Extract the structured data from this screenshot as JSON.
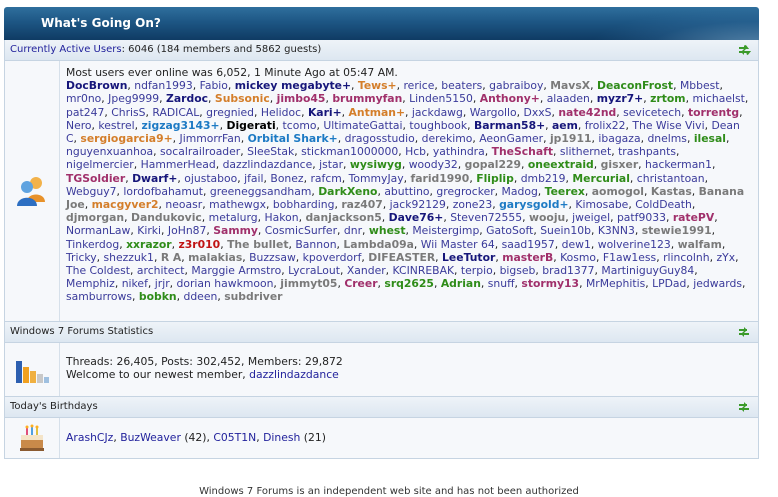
{
  "header": {
    "title": "What's Going On?"
  },
  "online": {
    "bar_label": "Currently Active Users",
    "bar_count": ": 6046 (184 members and 5862 guests)",
    "most_ever": "Most users ever online was 6,052, 1 Minute Ago at 05:47 AM.",
    "users_html_note": "list of user names",
    "users": [
      [
        "DocBrown",
        "ud"
      ],
      [
        "ndfan1993",
        "u"
      ],
      [
        "Fabio",
        "u"
      ],
      [
        "mickey megabyte+",
        "ud"
      ],
      [
        "Tews+",
        "ul"
      ],
      [
        "rerice",
        "u"
      ],
      [
        "beaters",
        "u"
      ],
      [
        "gabraiboy",
        "u"
      ],
      [
        "MavsX",
        "ug"
      ],
      [
        "DeaconFrost",
        "uf"
      ],
      [
        "Mbbest",
        "u"
      ],
      [
        "mr0no",
        "u"
      ],
      [
        "Jpeg9999",
        "u"
      ],
      [
        "Zardoc",
        "ud"
      ],
      [
        "Subsonic",
        "ul"
      ],
      [
        "jimbo45",
        "um"
      ],
      [
        "brummyfan",
        "um"
      ],
      [
        "Linden5150",
        "u"
      ],
      [
        "Anthony+",
        "um"
      ],
      [
        "alaaden",
        "u"
      ],
      [
        "myzr7+",
        "ud"
      ],
      [
        "zrtom",
        "uf"
      ],
      [
        "michaelst",
        "u"
      ],
      [
        "pat247",
        "u"
      ],
      [
        "ChrisS",
        "u"
      ],
      [
        "RADICAL",
        "u"
      ],
      [
        "gregnied",
        "u"
      ],
      [
        "Helidoc",
        "u"
      ],
      [
        "Kari+",
        "ud"
      ],
      [
        "Antman+",
        "ul"
      ],
      [
        "jackdawg",
        "u"
      ],
      [
        "Wargollo",
        "u"
      ],
      [
        "DxxS",
        "u"
      ],
      [
        "nate42nd",
        "um"
      ],
      [
        "sevicetech",
        "u"
      ],
      [
        "torrentg",
        "um"
      ],
      [
        "Nero",
        "u"
      ],
      [
        "kestrel",
        "u"
      ],
      [
        "zigzag3143+",
        "uc"
      ],
      [
        "Digerati",
        "ub"
      ],
      [
        "tcomo",
        "u"
      ],
      [
        "UltimateGattai",
        "u"
      ],
      [
        "toughbook",
        "u"
      ],
      [
        "Barman58+",
        "ud"
      ],
      [
        "aem",
        "ud"
      ],
      [
        "frolix22",
        "u"
      ],
      [
        "The Wise Vivi",
        "u"
      ],
      [
        "Dean C",
        "u"
      ],
      [
        "sergiogarcia9+",
        "ul"
      ],
      [
        "JimmorrFan",
        "u"
      ],
      [
        "Orbital Shark+",
        "uc"
      ],
      [
        "dragosstudio",
        "u"
      ],
      [
        "derekimo",
        "u"
      ],
      [
        "AeonGamer",
        "u"
      ],
      [
        "jp1911",
        "ug"
      ],
      [
        "ibagaza",
        "u"
      ],
      [
        "dnelms",
        "u"
      ],
      [
        "ilesal",
        "uf"
      ],
      [
        "nguyenxuanhoa",
        "u"
      ],
      [
        "socalrailroader",
        "u"
      ],
      [
        "SleeStak",
        "u"
      ],
      [
        "stickman1000000",
        "u"
      ],
      [
        "Hcb",
        "u"
      ],
      [
        "yathindra",
        "u"
      ],
      [
        "TheSchaft",
        "um"
      ],
      [
        "slithernet",
        "u"
      ],
      [
        "trashpants",
        "u"
      ],
      [
        "nigelmercier",
        "u"
      ],
      [
        "HammerHead",
        "u"
      ],
      [
        "dazzlindazdance",
        "u"
      ],
      [
        "jstar",
        "u"
      ],
      [
        "wysiwyg",
        "uf"
      ],
      [
        "woody32",
        "u"
      ],
      [
        "gopal229",
        "ug"
      ],
      [
        "oneextraid",
        "uf"
      ],
      [
        "gisxer",
        "ug"
      ],
      [
        "hackerman1",
        "u"
      ],
      [
        "TGSoldier",
        "um"
      ],
      [
        "Dwarf+",
        "ud"
      ],
      [
        "ojustaboo",
        "u"
      ],
      [
        "jfail",
        "u"
      ],
      [
        "Bonez",
        "u"
      ],
      [
        "rafcm",
        "u"
      ],
      [
        "TommyJay",
        "u"
      ],
      [
        "farid1990",
        "ug"
      ],
      [
        "Fliplip",
        "uf"
      ],
      [
        "dmb219",
        "u"
      ],
      [
        "Mercurial",
        "uf"
      ],
      [
        "christantoan",
        "u"
      ],
      [
        "Webguy7",
        "u"
      ],
      [
        "lordofbahamut",
        "u"
      ],
      [
        "greeneggsandham",
        "u"
      ],
      [
        "DarkXeno",
        "uf"
      ],
      [
        "abuttino",
        "u"
      ],
      [
        "gregrocker",
        "u"
      ],
      [
        "Madog",
        "u"
      ],
      [
        "Teerex",
        "uf"
      ],
      [
        "aomogol",
        "ug"
      ],
      [
        "Kastas",
        "ug"
      ],
      [
        "Banana Joe",
        "ug"
      ],
      [
        "macgyver2",
        "ul"
      ],
      [
        "neoasr",
        "u"
      ],
      [
        "mathewgx",
        "u"
      ],
      [
        "bobharding",
        "u"
      ],
      [
        "raz407",
        "ug"
      ],
      [
        "jack92129",
        "u"
      ],
      [
        "zone23",
        "u"
      ],
      [
        "garysgold+",
        "uc"
      ],
      [
        "Kimosabe",
        "u"
      ],
      [
        "ColdDeath",
        "u"
      ],
      [
        "djmorgan",
        "ug"
      ],
      [
        "Dandukovic",
        "ug"
      ],
      [
        "metalurg",
        "u"
      ],
      [
        "Hakon",
        "u"
      ],
      [
        "danjackson5",
        "ug"
      ],
      [
        "Dave76+",
        "ud"
      ],
      [
        "Steven72555",
        "u"
      ],
      [
        "wooju",
        "ug"
      ],
      [
        "jweigel",
        "u"
      ],
      [
        "patf9033",
        "u"
      ],
      [
        "ratePV",
        "um"
      ],
      [
        "NormanLaw",
        "u"
      ],
      [
        "Kirki",
        "u"
      ],
      [
        "JoHn87",
        "u"
      ],
      [
        "Sammy",
        "um"
      ],
      [
        "CosmicSurfer",
        "u"
      ],
      [
        "dnr",
        "u"
      ],
      [
        "whest",
        "uf"
      ],
      [
        "Meistergimp",
        "u"
      ],
      [
        "GatoSoft",
        "u"
      ],
      [
        "Suein10b",
        "u"
      ],
      [
        "K3NN3",
        "u"
      ],
      [
        "stewie1991",
        "ug"
      ],
      [
        "Tinkerdog",
        "u"
      ],
      [
        "xxrazor",
        "uf"
      ],
      [
        "z3r010",
        "ur"
      ],
      [
        "The bullet",
        "ug"
      ],
      [
        "Bannon",
        "u"
      ],
      [
        "Lambda09a",
        "ug"
      ],
      [
        "Wii Master 64",
        "u"
      ],
      [
        "saad1957",
        "u"
      ],
      [
        "dew1",
        "u"
      ],
      [
        "wolverine123",
        "u"
      ],
      [
        "walfam",
        "ug"
      ],
      [
        "Tricky",
        "u"
      ],
      [
        "shezzuk1",
        "u"
      ],
      [
        "R A",
        "ug"
      ],
      [
        "malakias",
        "ug"
      ],
      [
        "Buzzsaw",
        "u"
      ],
      [
        "kpoverdorf",
        "u"
      ],
      [
        "DIFEASTER",
        "ug"
      ],
      [
        "LeeTutor",
        "ud"
      ],
      [
        "masterB",
        "um"
      ],
      [
        "Kosmo",
        "u"
      ],
      [
        "F1aw1ess",
        "u"
      ],
      [
        "rlincolnh",
        "u"
      ],
      [
        "zYx",
        "u"
      ],
      [
        "The Coldest",
        "u"
      ],
      [
        "architect",
        "u"
      ],
      [
        "Marggie Armstro",
        "u"
      ],
      [
        "LycraLout",
        "u"
      ],
      [
        "Xander",
        "u"
      ],
      [
        "KCINREBAK",
        "u"
      ],
      [
        "terpio",
        "u"
      ],
      [
        "bigseb",
        "u"
      ],
      [
        "brad1377",
        "u"
      ],
      [
        "MartiniguyGuy84",
        "u"
      ],
      [
        "Memphiz",
        "u"
      ],
      [
        "nikef",
        "u"
      ],
      [
        "jrjr",
        "u"
      ],
      [
        "dorian hawkmoon",
        "u"
      ],
      [
        "jimmyt05",
        "ug"
      ],
      [
        "Creer",
        "um"
      ],
      [
        "srq2625",
        "uf"
      ],
      [
        "Adrian",
        "uf"
      ],
      [
        "snuff",
        "u"
      ],
      [
        "stormy13",
        "um"
      ],
      [
        "MrMephitis",
        "u"
      ],
      [
        "LPDad",
        "u"
      ],
      [
        "jedwards",
        "u"
      ],
      [
        "samburrows",
        "u"
      ],
      [
        "bobkn",
        "uf"
      ],
      [
        "ddeen",
        "u"
      ],
      [
        "subdriver",
        "ug"
      ]
    ]
  },
  "stats": {
    "bar_label": "Windows 7 Forums Statistics",
    "line1": "Threads: 26,405, Posts: 302,452, Members: 29,872",
    "welcome_prefix": "Welcome to our newest member, ",
    "newest_member": "dazzlindazdance"
  },
  "birthdays": {
    "bar_label": "Today's Birthdays",
    "people": [
      {
        "name": "ArashCJz",
        "age": ""
      },
      {
        "name": "BuzWeaver",
        "age": "(42)"
      },
      {
        "name": "C05T1N",
        "age": ""
      },
      {
        "name": "Dinesh",
        "age": "(21)"
      }
    ]
  },
  "footer": {
    "text": "Windows 7 Forums is an independent web site and has not been authorized"
  }
}
